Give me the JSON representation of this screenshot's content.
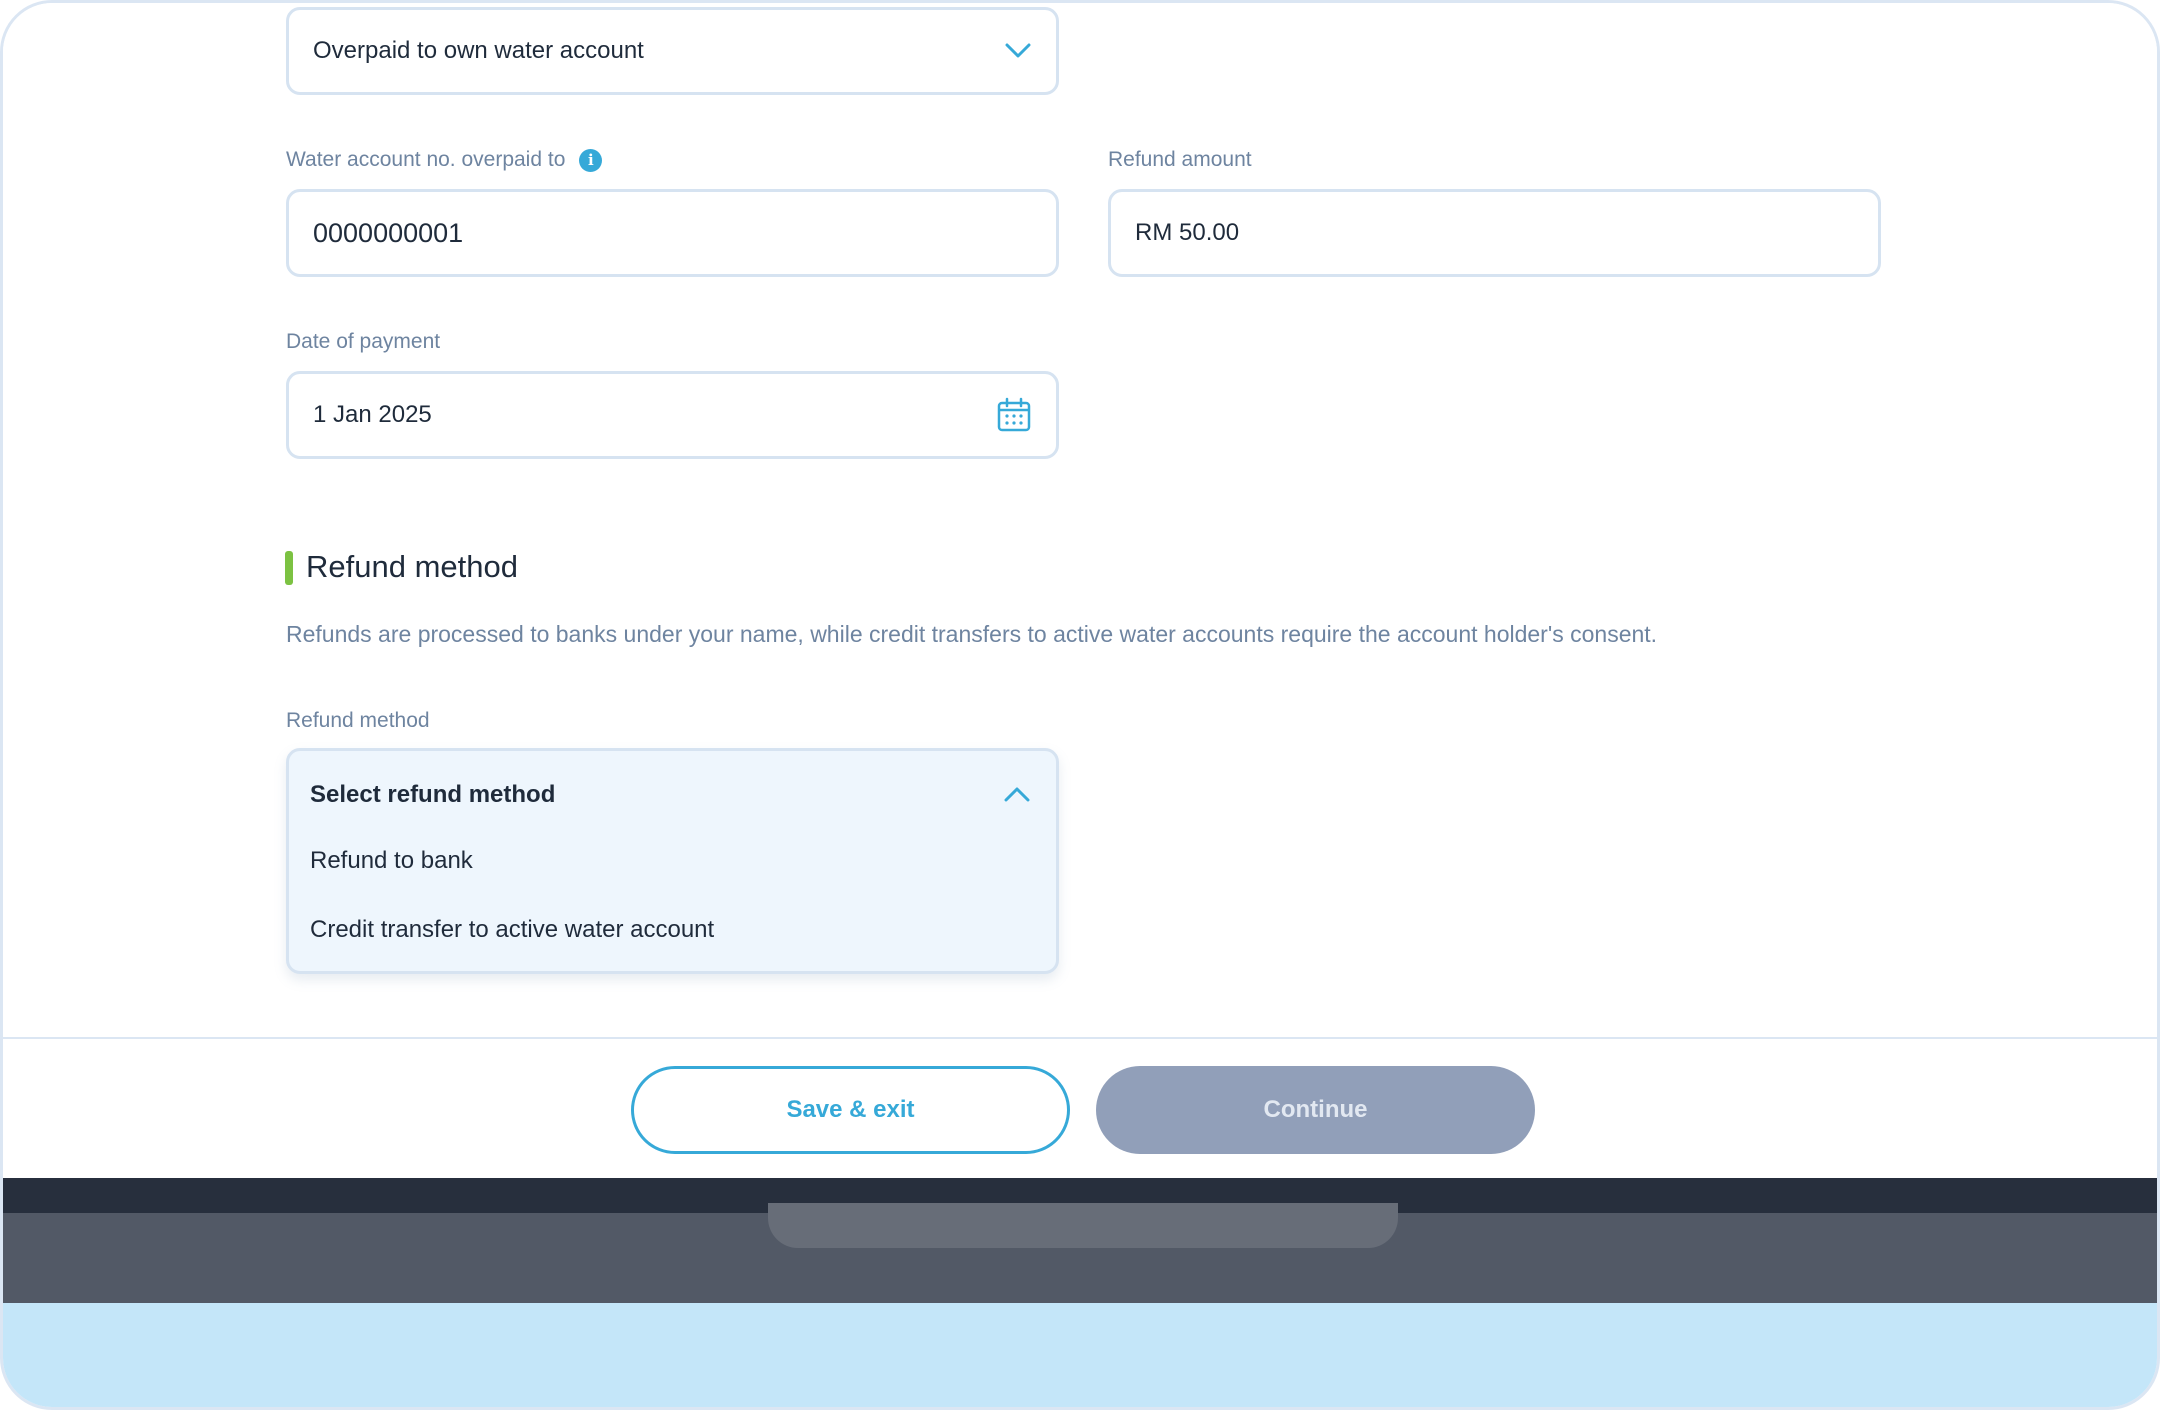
{
  "form": {
    "overpaid_type": {
      "value": "Overpaid to own water account"
    },
    "water_account": {
      "label": "Water account no. overpaid to",
      "value": "0000000001"
    },
    "refund_amount": {
      "label": "Refund amount",
      "value": "RM 50.00"
    },
    "date_of_payment": {
      "label": "Date of payment",
      "value": "1 Jan 2025"
    }
  },
  "refund_section": {
    "title": "Refund method",
    "description": "Refunds are processed to banks under your name, while credit transfers to active water accounts require the account holder's consent.",
    "field_label": "Refund method",
    "dropdown": {
      "placeholder": "Select refund method",
      "options": [
        "Refund to bank",
        "Credit transfer to active water account"
      ]
    }
  },
  "footer": {
    "save_exit_label": "Save & exit",
    "continue_label": "Continue"
  },
  "colors": {
    "accent": "#36a9d8",
    "section_marker": "#7cc242",
    "disabled_button": "#919fb9",
    "label_text": "#6e84a0"
  },
  "icons": {
    "dropdown_closed": "chevron-down-icon",
    "dropdown_open": "chevron-up-icon",
    "info": "info-icon",
    "date": "calendar-icon"
  }
}
